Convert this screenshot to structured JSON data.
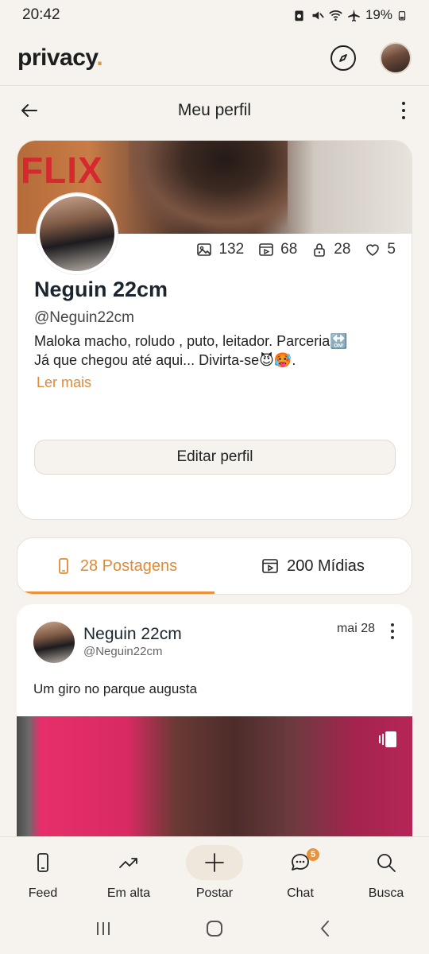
{
  "status_bar": {
    "time": "20:42",
    "battery": "19%"
  },
  "app": {
    "logo_text": "privacy",
    "logo_dot": "."
  },
  "page": {
    "title": "Meu perfil"
  },
  "profile": {
    "cover_text": "FLIX",
    "stats": {
      "photos": "132",
      "videos": "68",
      "locked": "28",
      "likes": "5"
    },
    "name": "Neguin 22cm",
    "handle": "@Neguin22cm",
    "bio_line1": "Maloka macho, roludo , puto, leitador. Parceria🔛",
    "bio_line2": "Já que chegou até aqui... Divirta-se😈🥵.",
    "read_more": "Ler mais",
    "edit_button": "Editar perfil"
  },
  "tabs": [
    {
      "label": "28 Postagens",
      "active": true
    },
    {
      "label": "200 Mídias",
      "active": false
    }
  ],
  "post": {
    "author_name": "Neguin 22cm",
    "author_handle": "@Neguin22cm",
    "date": "mai 28",
    "text": "Um giro no parque augusta"
  },
  "bottom_nav": [
    {
      "label": "Feed",
      "icon": "phone-icon"
    },
    {
      "label": "Em alta",
      "icon": "trending-icon"
    },
    {
      "label": "Postar",
      "icon": "plus-icon"
    },
    {
      "label": "Chat",
      "icon": "chat-icon",
      "badge": "5"
    },
    {
      "label": "Busca",
      "icon": "search-icon"
    }
  ],
  "colors": {
    "accent": "#e8923a",
    "background": "#f6f3ef",
    "card": "#ffffff"
  }
}
